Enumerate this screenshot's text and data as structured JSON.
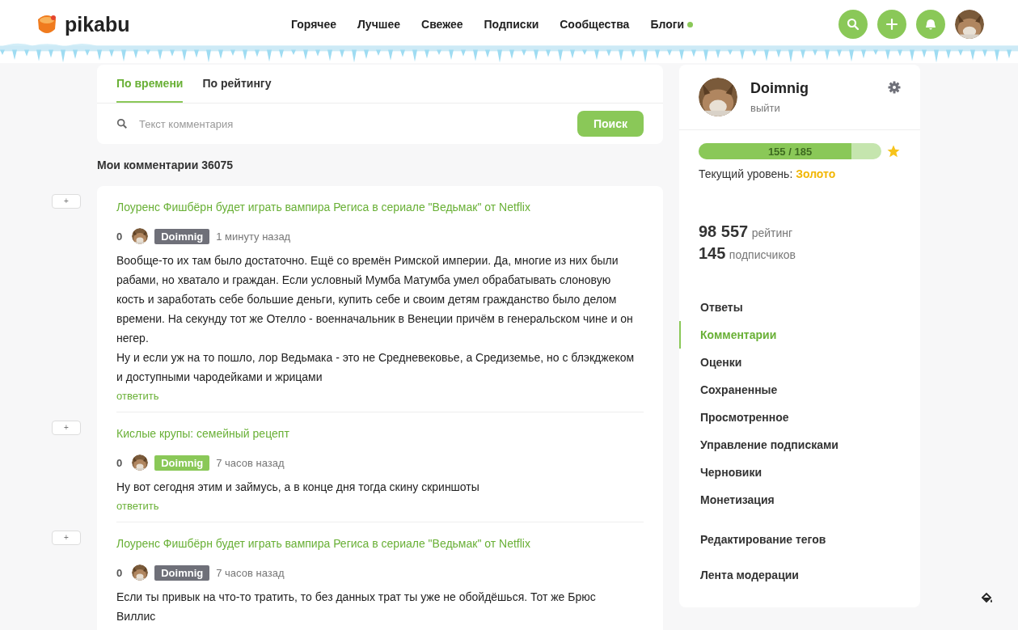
{
  "header": {
    "logo": "pikabu",
    "nav": [
      {
        "label": "Горячее",
        "dot": false
      },
      {
        "label": "Лучшее",
        "dot": false
      },
      {
        "label": "Свежее",
        "dot": false
      },
      {
        "label": "Подписки",
        "dot": false
      },
      {
        "label": "Сообщества",
        "dot": false
      },
      {
        "label": "Блоги",
        "dot": true
      }
    ]
  },
  "tabs": [
    {
      "label": "По времени",
      "selected": true
    },
    {
      "label": "По рейтингу",
      "selected": false
    }
  ],
  "search": {
    "placeholder": "Текст комментария",
    "button": "Поиск"
  },
  "count_label": "Мои комментарии",
  "count": "36075",
  "comments": [
    {
      "plus": "+",
      "title": "Лоуренс Фишбёрн будет играть вампира Региса в сериале \"Ведьмак\" от Netflix",
      "rating": "0",
      "author": "Doimnig",
      "color": "#6f7079",
      "time": "1 минуту назад",
      "paragraphs": [
        "Вообще-то их там было достаточно. Ещё со времён Римской империи. Да, многие из них были рабами, но хватало и граждан. Если условный Мумба Матумба умел обрабатывать слоновую кость и заработать себе большие деньги, купить себе и своим детям гражданство было делом времени. На секунду тот же Отелло - военначальник в Венеции причём в генеральском чине и он негер.",
        "Ну и если уж на то пошло, лор Ведьмака - это не Средневековье, а Средиземье, но с блэкджеком и доступными чародейками и жрицами"
      ],
      "reply": "ответить"
    },
    {
      "plus": "+",
      "title": "Кислые крупы: семейный рецепт",
      "rating": "0",
      "author": "Doimnig",
      "color": "#8ac858",
      "time": "7 часов назад",
      "paragraphs": [
        "Ну вот сегодня этим и займусь, а в конце дня тогда скину скриншоты"
      ],
      "reply": "ответить"
    },
    {
      "plus": "+",
      "title": "Лоуренс Фишбёрн будет играть вампира Региса в сериале \"Ведьмак\" от Netflix",
      "rating": "0",
      "author": "Doimnig",
      "color": "#6f7079",
      "time": "7 часов назад",
      "paragraphs": [
        "Если ты привык на что-то тратить, то без данных трат ты уже не обойдёшься. Тот же Брюс Виллис"
      ]
    }
  ],
  "profile": {
    "name": "Doimnig",
    "logout": "выйти",
    "progress_text": "155 / 185",
    "level": 0.838,
    "level_label": "Текущий уровень:",
    "level_value": "Золото",
    "rating": "98 557",
    "rating_label": "рейтинг",
    "subscribers": "145",
    "subscribers_label": "подписчиков"
  },
  "menu": [
    {
      "label": "Ответы",
      "selected": false
    },
    {
      "label": "Комментарии",
      "selected": true
    },
    {
      "label": "Оценки",
      "selected": false
    },
    {
      "label": "Сохраненные",
      "selected": false
    },
    {
      "label": "Просмотренное",
      "selected": false
    },
    {
      "label": "Управление подписками",
      "selected": false
    },
    {
      "label": "Черновики",
      "selected": false
    },
    {
      "label": "Монетизация",
      "selected": false
    }
  ],
  "menu_extra": [
    {
      "label": "Редактирование тегов",
      "selected": false
    },
    {
      "label": "Лента модерации",
      "selected": false
    }
  ]
}
